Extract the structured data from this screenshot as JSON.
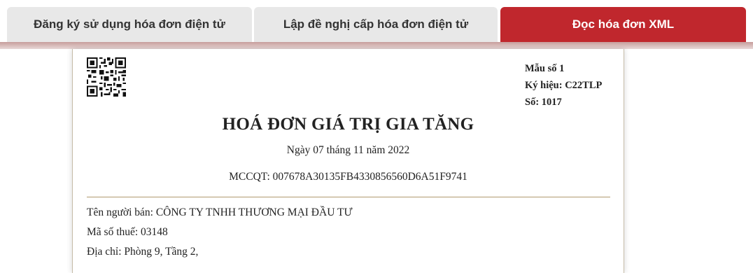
{
  "tabs": [
    {
      "label": "Đăng ký sử dụng hóa đơn điện tử",
      "active": false
    },
    {
      "label": "Lập đề nghị cấp hóa đơn điện tử",
      "active": false
    },
    {
      "label": "Đọc hóa đơn XML",
      "active": true
    }
  ],
  "colors": {
    "accent": "#c0272d",
    "tab_inactive": "#e8e8e8"
  },
  "invoice": {
    "qr_icon": "qr-code",
    "form_number": "Mẫu số 1",
    "symbol": "Ký hiệu: C22TLP",
    "number": "Số: 1017",
    "title": "HOÁ ĐƠN GIÁ TRỊ GIA TĂNG",
    "date": "Ngày 07 tháng 11 năm 2022",
    "mccqt": "MCCQT: 007678A30135FB4330856560D6A51F9741",
    "seller": {
      "name": "Tên người bán: CÔNG TY TNHH THƯƠNG MẠI ĐẦU TƯ",
      "tax_code": "Mã số thuế: 03148",
      "address": "Địa chỉ: Phòng 9, Tầng 2,"
    }
  }
}
